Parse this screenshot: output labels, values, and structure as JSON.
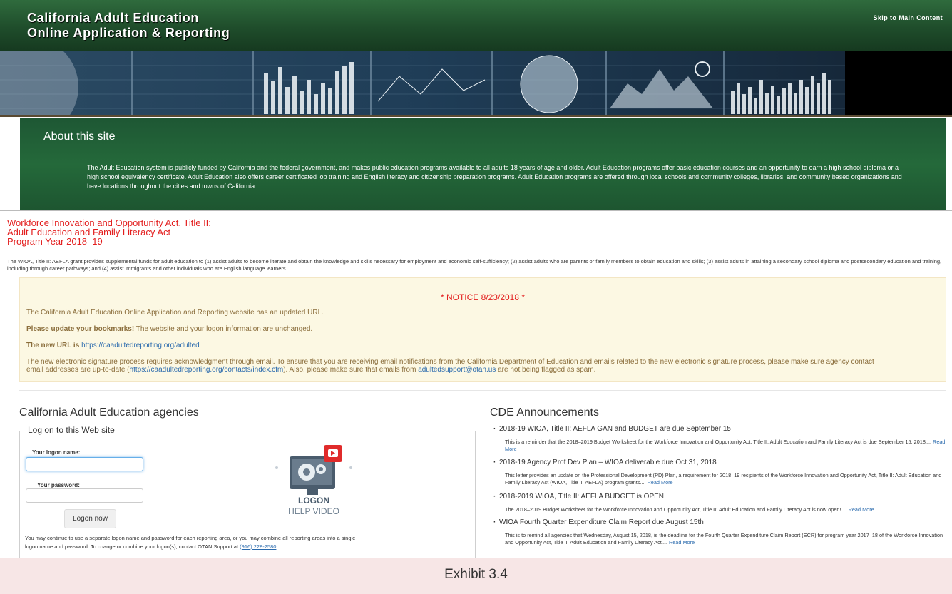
{
  "header": {
    "title_line1": "California Adult Education",
    "title_line2": "Online Application & Reporting",
    "skip_link": "Skip to Main Content",
    "bg_color": "#1f4d2b"
  },
  "about": {
    "heading": "About this site",
    "body": "The Adult Education system is publicly funded by California and the federal government, and makes public education programs available to all adults 18 years of age and older. Adult Education programs offer basic education courses and an opportunity to earn a high school diploma or a high school equivalency certificate. Adult Education also offers career certificated job training and English literacy and citizenship preparation programs. Adult Education programs are offered through local schools and community colleges, libraries, and community based organizations and have locations throughout the cities and towns of California."
  },
  "wioa": {
    "title_line1": "Workforce Innovation and Opportunity Act, Title II:",
    "title_line2": "Adult Education and Family Literacy Act",
    "title_line3": "Program Year 2018–19",
    "description": "The WIOA, Title II: AEFLA grant provides supplemental funds for adult education to (1) assist adults to become literate and obtain the knowledge and skills necessary for employment and economic self-sufficiency; (2) assist adults who are parents or family members to obtain education and skills; (3) assist adults in attaining a secondary school diploma and postsecondary education and training, including through career pathways; and (4) assist immigrants and other individuals who are English language learners."
  },
  "notice": {
    "heading": "* NOTICE 8/23/2018 *",
    "line1": "The California Adult Education Online Application and Reporting website has an updated URL.",
    "line2_bold": "Please update your bookmarks!",
    "line2_rest": " The website and your logon information are unchanged.",
    "line3_bold": "The new URL is",
    "line3_link": "https://caadultedreporting.org/adulted",
    "line4_a": "The new electronic signature process requires acknowledgment through email. To ensure that you are receiving email notifications from the California Department of Education and emails related to the new electronic signature process, please make sure agency contact",
    "line4_b_pre": "email addresses are up-to-date (",
    "line4_b_link": "https://caadultedreporting.org/contacts/index.cfm",
    "line4_b_mid": "). Also, please make sure that emails from ",
    "line4_b_email": "adultedsupport@otan.us",
    "line4_b_post": " are not being flagged as spam."
  },
  "agencies": {
    "heading": "California Adult Education agencies",
    "legend": "Log on to this Web site",
    "logon_name_label": "Your logon name:",
    "password_label": "Your password:",
    "logon_button": "Logon now",
    "video_word": "LOGON",
    "video_sub": "HELP VIDEO",
    "note_line1": "You may continue to use a separate logon name and password for each reporting area, or you may combine all reporting areas into a single",
    "note_line2": "logon name and password. To change or combine your logon(s), contact OTAN Support at",
    "note_phone": "(916) 228-2580",
    "note_end": "."
  },
  "cde": {
    "heading": "CDE Announcements",
    "read_more": "Read More",
    "items": [
      {
        "title": "2018-19 WIOA, Title II: AEFLA GAN and BUDGET are due September 15",
        "body": "This is a reminder that the 2018–2019 Budget Worksheet for the Workforce Innovation and Opportunity Act, Title II: Adult Education and Family Literacy Act is due September 15, 2018...."
      },
      {
        "title": "2018-19 Agency Prof Dev Plan – WIOA deliverable due Oct 31, 2018",
        "body": "This letter provides an update on the Professional Development (PD) Plan, a requirement for 2018–19 recipients of the Workforce Innovation and Opportunity Act, Title II: Adult Education and Family Literacy Act (WIOA, Title II: AEFLA) program grants...."
      },
      {
        "title": "2018-2019 WIOA, Title II: AEFLA BUDGET is OPEN",
        "body": "The 2018–2019 Budget Worksheet for the Workforce Innovation and Opportunity Act, Title II: Adult Education and Family Literacy Act is now open!...."
      },
      {
        "title": "WIOA Fourth Quarter Expenditure Claim Report due August 15th",
        "body": "This is to remind all agencies that Wednesday, August 15, 2018, is the deadline for the Fourth Quarter Expenditure Claim Report (ECR) for program year 2017–18 of the Workforce Innovation and Opportunity Act, Title II: Adult Education and Family Literacy Act...."
      }
    ]
  },
  "exhibit": {
    "label": "Exhibit 3.4"
  },
  "colors": {
    "accent_red": "#e31e1e",
    "link_blue": "#2a6aad",
    "notice_bg": "#fcf8e3",
    "notice_text": "#8a6d3b"
  }
}
